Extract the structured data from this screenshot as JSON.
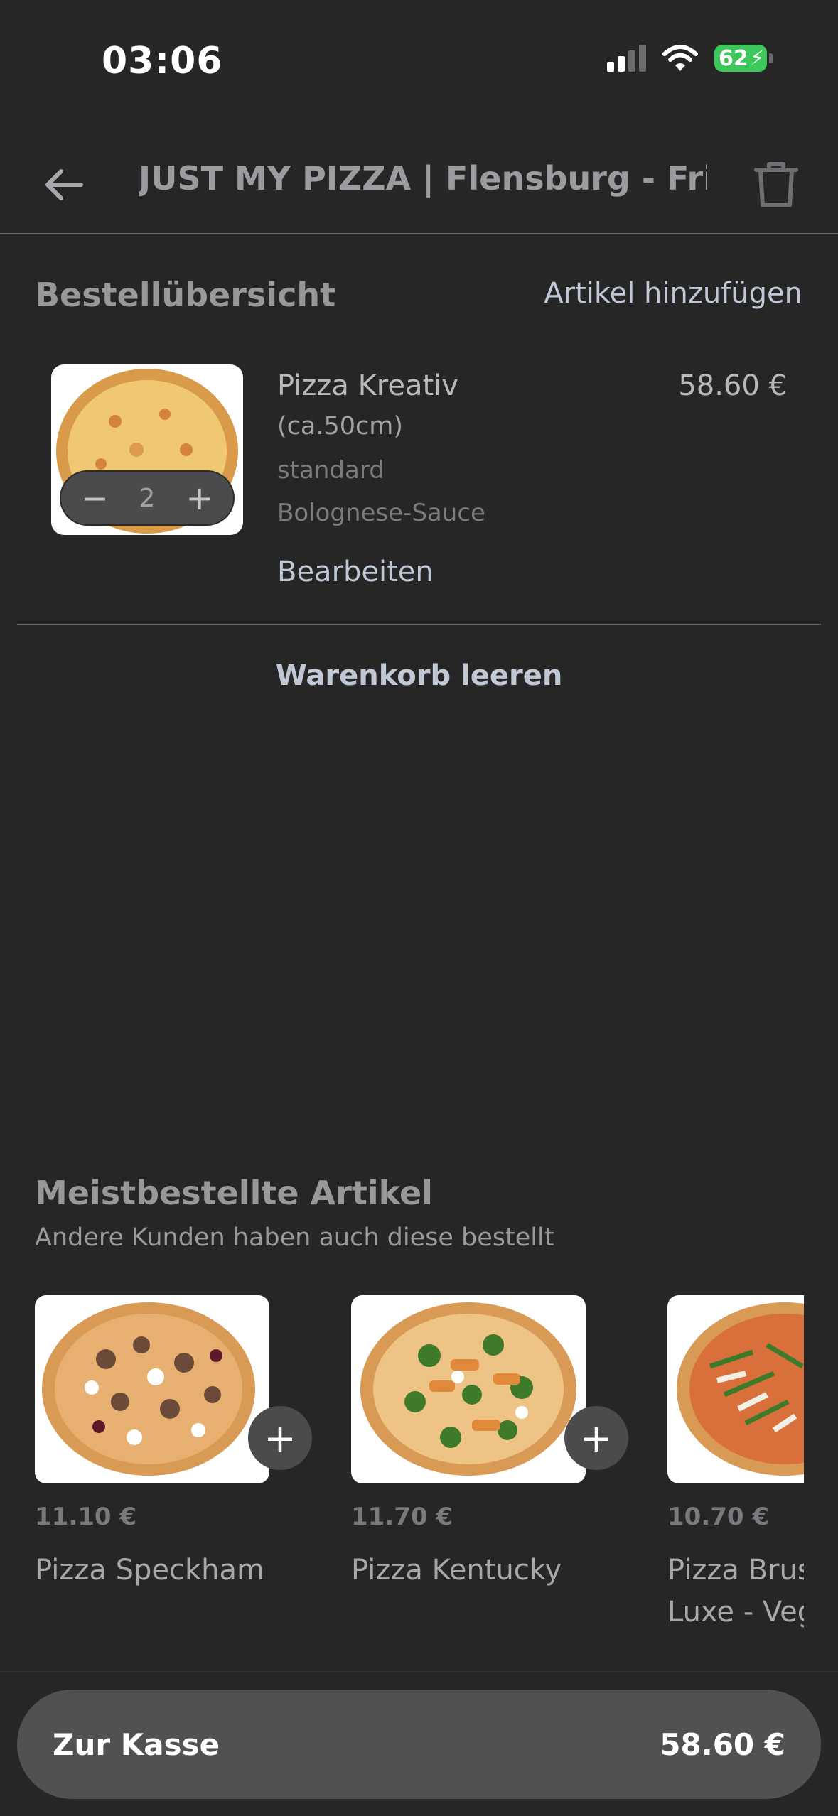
{
  "status": {
    "time": "03:06",
    "battery": "62"
  },
  "header": {
    "title": "JUST MY PIZZA | Flensburg - Frie..."
  },
  "order": {
    "title": "Bestellübersicht",
    "add_link": "Artikel hinzufügen",
    "item": {
      "name": "Pizza Kreativ",
      "size": "(ca.50cm)",
      "options": [
        "standard",
        "Bolognese-Sauce"
      ],
      "edit": "Bearbeiten",
      "price": "58.60 €",
      "quantity": "2"
    },
    "clear_cart": "Warenkorb leeren"
  },
  "recommendations": {
    "title": "Meistbestellte Artikel",
    "subtitle": "Andere Kunden haben auch diese bestellt",
    "items": [
      {
        "price": "11.10 €",
        "name": "Pizza Speckham"
      },
      {
        "price": "11.70 €",
        "name": "Pizza Kentucky"
      },
      {
        "price": "10.70 €",
        "name": "Pizza Brus",
        "name_line2": "Luxe - Veg"
      }
    ]
  },
  "checkout": {
    "label": "Zur Kasse",
    "total": "58.60 €"
  },
  "colors": {
    "background": "#262627",
    "link": "#c0c8d6",
    "button": "#4f5153",
    "battery": "#3ec75a"
  }
}
